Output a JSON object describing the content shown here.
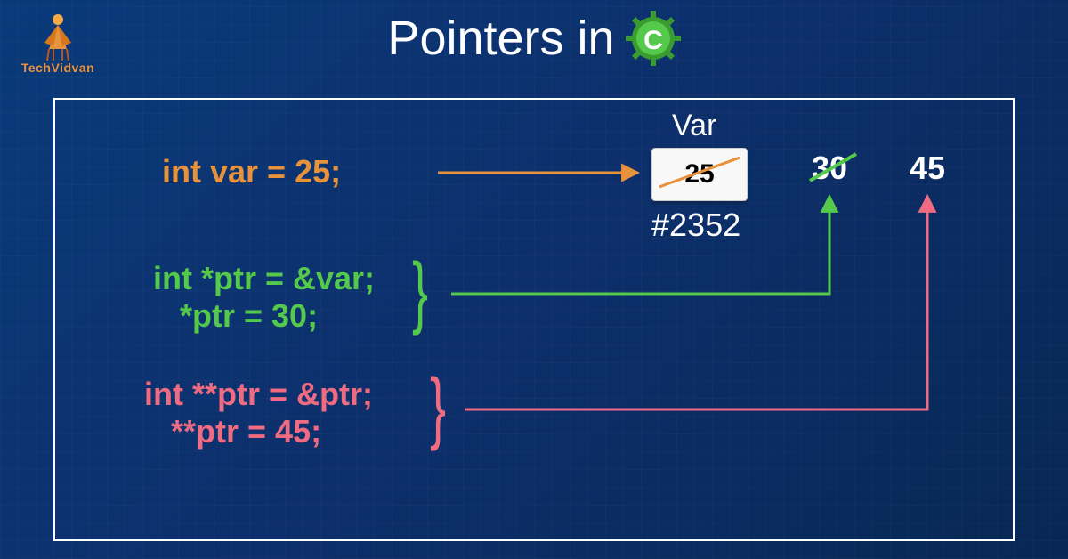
{
  "title": "Pointers in",
  "logo": "TechVidvan",
  "code": {
    "line1": "int var = 25;",
    "line2a": "int *ptr = &var;",
    "line2b": "   *ptr = 30;",
    "line3a": "int **ptr = &ptr;",
    "line3b": "   **ptr = 45;"
  },
  "diagram": {
    "var_label": "Var",
    "var_value": "25",
    "address": "#2352",
    "value_after_ptr": "30",
    "value_after_dptr": "45"
  },
  "colors": {
    "orange": "#e8923c",
    "green": "#55c94b",
    "pink": "#ef6b82"
  },
  "c_letter": "C"
}
